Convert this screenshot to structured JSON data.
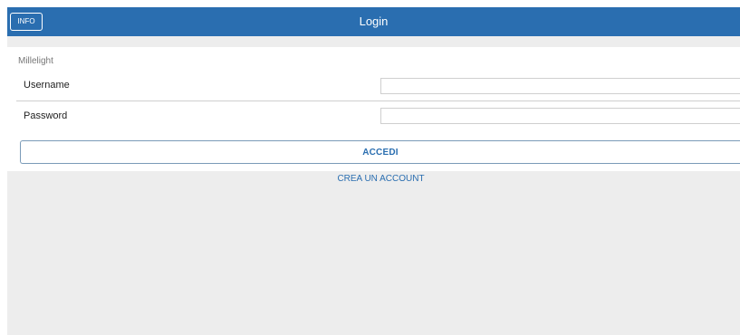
{
  "header": {
    "info_label": "INFO",
    "title": "Login"
  },
  "form": {
    "app_name": "Millelight",
    "username_label": "Username",
    "username_value": "",
    "password_label": "Password",
    "password_value": "",
    "submit_label": "ACCEDI"
  },
  "links": {
    "create_account": "CREA UN ACCOUNT"
  },
  "colors": {
    "header_bg": "#2a6eb0",
    "page_bg": "#ededed",
    "accent": "#2a6eb0"
  }
}
